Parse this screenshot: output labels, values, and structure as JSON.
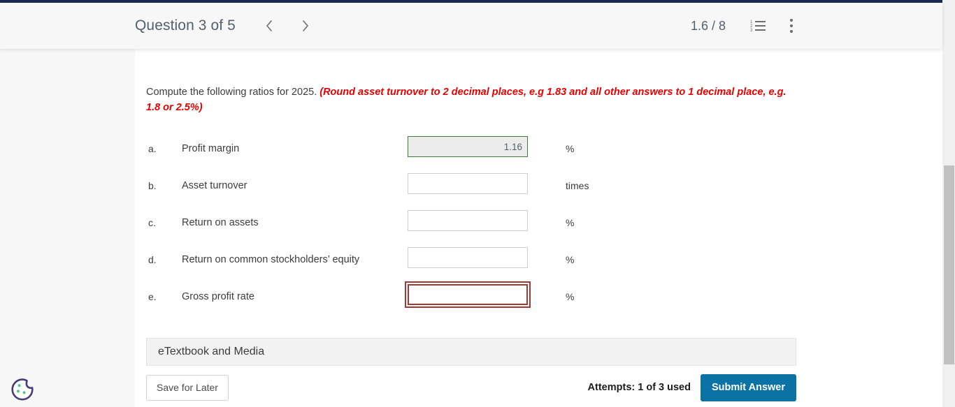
{
  "header": {
    "title": "Question 3 of 5",
    "prev_label": "Previous question",
    "next_label": "Next question",
    "progress": "1.6 / 8",
    "list_icon": "numbered-list-icon",
    "menu_icon": "kebab-menu-icon",
    "list_numbers": [
      "1",
      "2",
      "3"
    ]
  },
  "question": {
    "prompt": "Compute the following ratios for 2025. ",
    "emphasis": "(Round asset turnover to 2 decimal places, e.g 1.83 and all other answers to 1 decimal place, e.g. 1.8 or 2.5%)"
  },
  "rows": [
    {
      "letter": "a.",
      "label": "Profit margin",
      "value": "1.16",
      "unit": "%",
      "state": "answered"
    },
    {
      "letter": "b.",
      "label": "Asset turnover",
      "value": "",
      "unit": "times",
      "state": "empty"
    },
    {
      "letter": "c.",
      "label": "Return on assets",
      "value": "",
      "unit": "%",
      "state": "empty"
    },
    {
      "letter": "d.",
      "label": "Return on common stockholders’ equity",
      "value": "",
      "unit": "%",
      "state": "empty"
    },
    {
      "letter": "e.",
      "label": "Gross profit rate",
      "value": "",
      "unit": "%",
      "state": "focused"
    }
  ],
  "etextbook": {
    "label": "eTextbook and Media"
  },
  "footer": {
    "save_label": "Save for Later",
    "attempts": "Attempts: 1 of 3 used",
    "submit_label": "Submit Answer"
  },
  "cookie": {
    "icon": "cookie-consent-icon"
  },
  "colors": {
    "navy_strip": "#1b2a4e",
    "header_bg": "#f7f7f7",
    "submit_blue": "#0b72a6",
    "emphasis_red": "#e60000",
    "focus_maroon": "#a03a36",
    "answered_green": "#3f7a3f",
    "cookie_outline": "#463d78",
    "cookie_dot": "#4ec98a"
  }
}
